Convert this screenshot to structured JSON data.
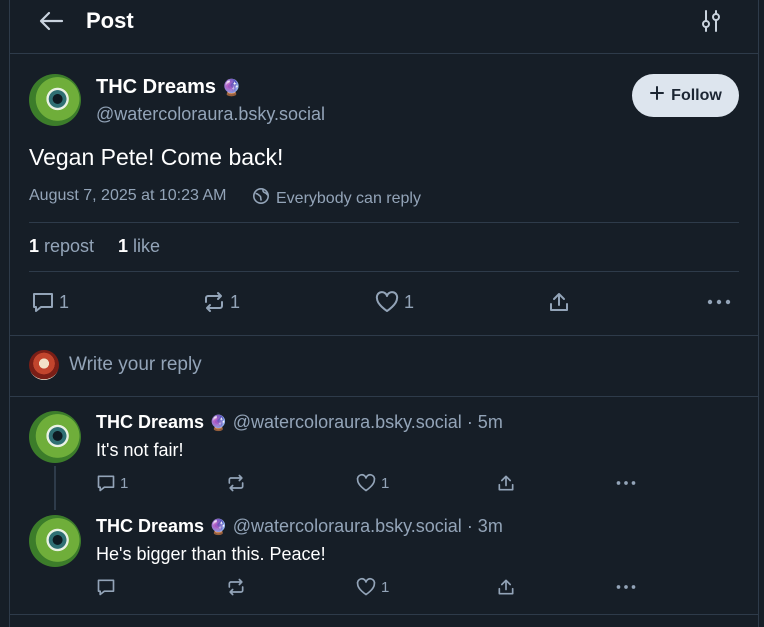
{
  "header": {
    "title": "Post"
  },
  "post": {
    "author": {
      "display_name": "THC Dreams",
      "badge": "🔮",
      "handle": "@watercoloraura.bsky.social"
    },
    "follow_label": "Follow",
    "text": "Vegan Pete!  Come back!",
    "timestamp": "August 7, 2025 at 10:23 AM",
    "reply_setting": "Everybody can reply",
    "stats": {
      "reposts_count": "1",
      "reposts_label": "repost",
      "likes_count": "1",
      "likes_label": "like"
    },
    "actions": {
      "replies": "1",
      "reposts": "1",
      "likes": "1"
    }
  },
  "composer": {
    "placeholder": "Write your reply"
  },
  "replies": [
    {
      "display_name": "THC Dreams",
      "badge": "🔮",
      "handle": "@watercoloraura.bsky.social",
      "time": "· 5m",
      "text": "It's not fair!",
      "replies": "1",
      "reposts": "",
      "likes": "1"
    },
    {
      "display_name": "THC Dreams",
      "badge": "🔮",
      "handle": "@watercoloraura.bsky.social",
      "time": "· 3m",
      "text": "He's bigger than this.  Peace!",
      "replies": "",
      "reposts": "",
      "likes": "1"
    }
  ],
  "icons": [
    "back-arrow-icon",
    "settings-sliders-icon",
    "plus-icon",
    "globe-icon",
    "reply-icon",
    "repost-icon",
    "like-icon",
    "share-icon",
    "more-icon"
  ]
}
